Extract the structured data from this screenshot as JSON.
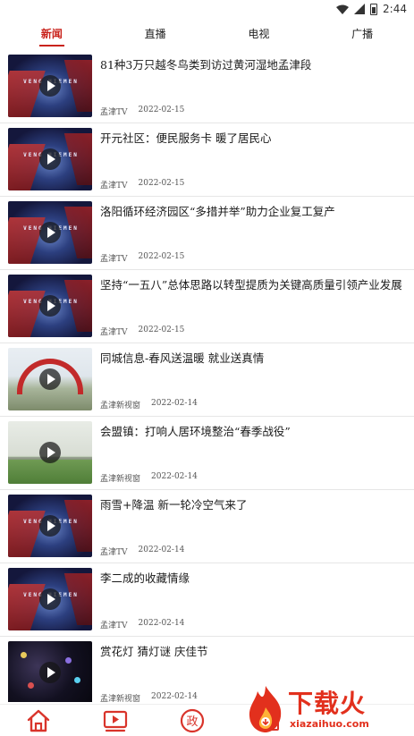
{
  "status_bar": {
    "time": "2:44"
  },
  "tabs": [
    {
      "label": "新闻",
      "active": true
    },
    {
      "label": "直播",
      "active": false
    },
    {
      "label": "电视",
      "active": false
    },
    {
      "label": "广播",
      "active": false
    }
  ],
  "thumbnail_studio_text": "VENG HIEMEN",
  "news": [
    {
      "title": "81种3万只越冬鸟类到访过黄河湿地孟津段",
      "source": "孟津TV",
      "date": "2022-02-15",
      "thumb": "studio"
    },
    {
      "title": "开元社区：便民服务卡 暖了居民心",
      "source": "孟津TV",
      "date": "2022-02-15",
      "thumb": "studio"
    },
    {
      "title": "洛阳循环经济园区“多措并举”助力企业复工复产",
      "source": "孟津TV",
      "date": "2022-02-15",
      "thumb": "studio"
    },
    {
      "title": "坚持“一五八”总体思路以转型提质为关键高质量引领产业发展",
      "source": "孟津TV",
      "date": "2022-02-15",
      "thumb": "studio"
    },
    {
      "title": "同城信息-春风送温暖 就业送真情",
      "source": "孟津新视窗",
      "date": "2022-02-14",
      "thumb": "arch"
    },
    {
      "title": "会盟镇：打响人居环境整治“春季战役”",
      "source": "孟津新视窗",
      "date": "2022-02-14",
      "thumb": "field"
    },
    {
      "title": "雨雪+降温 新一轮冷空气来了",
      "source": "孟津TV",
      "date": "2022-02-14",
      "thumb": "studio"
    },
    {
      "title": "李二成的收藏情缘",
      "source": "孟津TV",
      "date": "2022-02-14",
      "thumb": "studio"
    },
    {
      "title": "赏花灯 猜灯谜 庆佳节",
      "source": "孟津新视窗",
      "date": "2022-02-14",
      "thumb": "night"
    }
  ],
  "bottom_nav": [
    {
      "icon": "home-icon"
    },
    {
      "icon": "video-icon"
    },
    {
      "icon": "zheng-icon",
      "glyph": "政"
    },
    {
      "icon": "tile-icon"
    }
  ],
  "watermark": {
    "text": "下载火",
    "url": "xiazaihuo.com"
  },
  "colors": {
    "accent": "#c9231c",
    "watermark": "#e2301d"
  }
}
